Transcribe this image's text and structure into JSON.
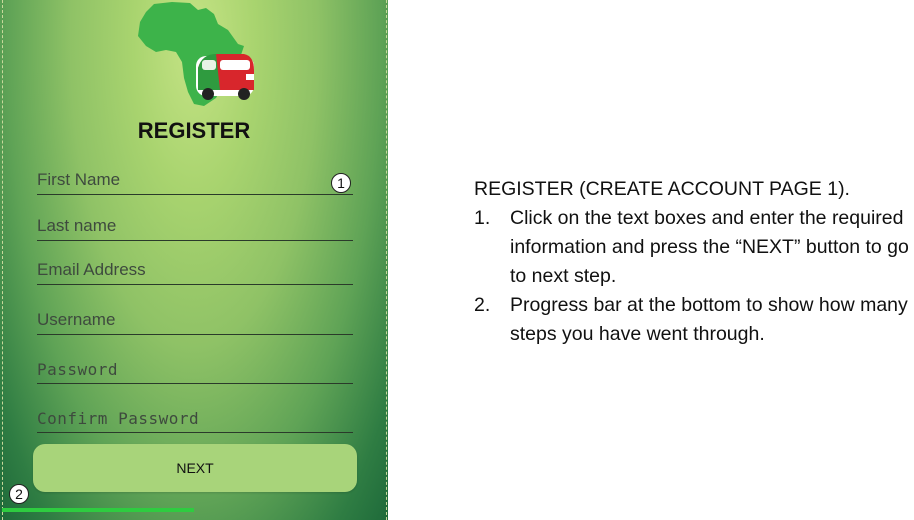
{
  "screen": {
    "title": "REGISTER",
    "fields": [
      {
        "placeholder": "First Name"
      },
      {
        "placeholder": "Last name"
      },
      {
        "placeholder": "Email Address"
      },
      {
        "placeholder": "Username"
      },
      {
        "placeholder": "Password"
      },
      {
        "placeholder": "Confirm Password"
      }
    ],
    "next_label": "NEXT",
    "progress_fraction": 0.5,
    "colors": {
      "progress": "#2ecc40",
      "button": "#a8d47a",
      "map": "#3db34a",
      "van": "#d8262c"
    }
  },
  "markers": {
    "m1": "1",
    "m2": "2"
  },
  "instructions": {
    "heading": "REGISTER (CREATE ACCOUNT PAGE 1).",
    "items": [
      {
        "num": "1.",
        "text": "Click on the text boxes and enter the required information and press the “NEXT” button to go to next step."
      },
      {
        "num": "2.",
        "text": "Progress bar at the bottom to show how many steps you have went through."
      }
    ]
  }
}
